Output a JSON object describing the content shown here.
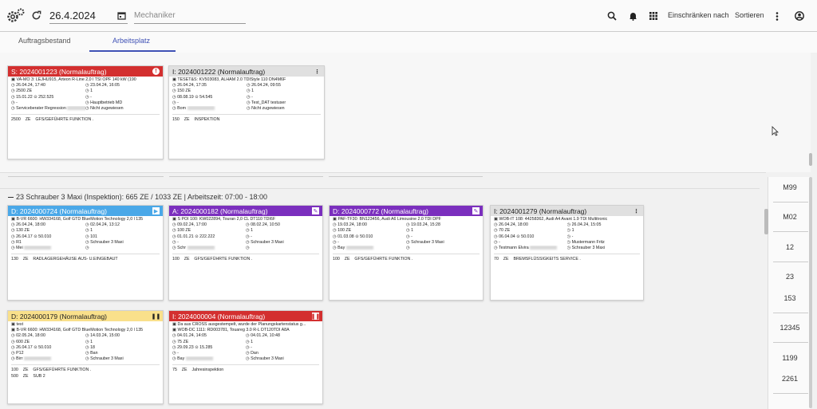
{
  "topbar": {
    "date": "26.4.2024",
    "mechanic_placeholder": "Mechaniker",
    "restrict": "Einschränken nach",
    "sort": "Sortieren"
  },
  "tabs": [
    "Auftragsbestand",
    "Arbeitsplatz"
  ],
  "group_header": "23 Schrauber 3 Maxi (Inspektion): 665 ZE / 1033 ZE | Arbeitszeit: 07:00 - 18:00",
  "side_values": [
    "M99",
    "M02",
    "12",
    "23",
    "153",
    "12345",
    "1199",
    "2261"
  ],
  "cards": [
    {
      "title": "S: 2024001223 (Normalauftrag)",
      "color": "red",
      "flag": "!",
      "vehicle": "VA-MO 3: LEJHU915, Arteon R-Line 2,0 l TSI OPF 140 kW (190",
      "l1": "26.04.24, 17:40",
      "r1": "23.04.24, 16:05",
      "l2": "2500 ZE",
      "r2": "1",
      "l3": "15.01.22",
      "l3b": "252.525",
      "r3": "-",
      "l4": "-",
      "r4": "Hauptbetrieb MD",
      "l5": "Serviceberater Regression",
      "r5": "Nicht zugewiesen",
      "f1a": "2500",
      "f1b": "ZE",
      "f1c": "GFS/GEFÜHRTE FUNKTION ."
    },
    {
      "title": "I: 2024001222 (Normalauftrag)",
      "color": "grey",
      "vehicle": "TESET&S: KV503083, ALHAM 2.0 TDIStyle 110 DN4M6F",
      "l1": "26.04.24, 17:35",
      "r1": "26.04.24, 09:55",
      "l2": "150 ZE",
      "r2": "1",
      "l3": "08.08.19",
      "l3b": "54.545",
      "r3": "-",
      "l4": "-",
      "r4": "Test_DAT testuser",
      "l5": "Bom",
      "r5": "Nicht zugewiesen",
      "f1a": "150",
      "f1b": "ZE",
      "f1c": "INSPEKTION"
    },
    {
      "title": "D: 2024000724 (Normalauftrag)",
      "color": "blue",
      "vehicle": "B-VR 6600: HW334168, Golf GTD BlueMotion Technology 2,0 l 135",
      "l1": "26.04.24, 18:00",
      "r1": "02.04.24, 13:12",
      "l2": "130 ZE",
      "r2": "1",
      "l3": "26.04.17",
      "l3b": "50.010",
      "r3": "101",
      "l4": "R1",
      "r4": "Schrauber 3 Maxi",
      "l5": "Mei",
      "r5": "",
      "f1a": "130",
      "f1b": "ZE",
      "f1c": "RADLAGERGEHÄUSE AUS- U.EINGEBAUT"
    },
    {
      "title": "A: 2024000182 (Normalauftrag)",
      "color": "purple",
      "vehicle": "S POI 100: KW022894, Touran 2,0 CL DT110 TDI6F",
      "l1": "09.02.24, 17:00",
      "r1": "08.02.24, 10:50",
      "l2": "100 ZE",
      "r2": "1",
      "l3": "01.01.21",
      "l3b": "222.222",
      "r3": "-",
      "l4": "-",
      "r4": "Schrauber 3 Maxi",
      "l5": "Schr",
      "r5": "",
      "f1a": "100",
      "f1b": "ZE",
      "f1c": "GFS/GEFÜHRTE FUNKTION ."
    },
    {
      "title": "D: 2024000772 (Normalauftrag)",
      "color": "purple",
      "vehicle": "PAF-TF30: BN123456, Audi A6 Limousine 2.0 TDI DPF",
      "l1": "19.03.24, 18:00",
      "r1": "19.03.24, 15:28",
      "l2": "100 ZE",
      "r2": "1",
      "l3": "01.03.08",
      "l3b": "50.010",
      "r3": "-",
      "l4": "-",
      "r4": "Schrauber 3 Maxi",
      "l5": "Bay",
      "r5": "",
      "f1a": "100",
      "f1b": "ZE",
      "f1c": "GFS/GEFÜHRTE FUNKTION ."
    },
    {
      "title": "I: 2024001279 (Normalauftrag)",
      "color": "grey",
      "vehicle": "WOB-IT 108: 44258362, Audi A4 Avant 1.9 TDI Multitronic",
      "l1": "26.04.24, 18:00",
      "r1": "26.04.24, 15:05",
      "l2": "70 ZE",
      "r2": "1",
      "l3": "06.04.04",
      "l3b": "50.010",
      "r3": "-",
      "l4": "-",
      "r4": "Mustermann Fritz",
      "l5": "Testmann Elvira",
      "r5": "Schrauber 3 Maxi",
      "f1a": "70",
      "f1b": "ZE",
      "f1c": "BREMSFLÜSSIGKEITS SERVICE ."
    },
    {
      "title": "D: 2024000179 (Normalauftrag)",
      "color": "yellow",
      "vehicle": "test",
      "vehicle2": "B-VR 6600: HW334168, Golf GTD BlueMotion Technology 2,0 l 135",
      "l1": "02.05.24, 18:00",
      "r1": "14.03.24, 15:00",
      "l2": "600 ZE",
      "r2": "1",
      "l3": "26.04.17",
      "l3b": "50.010",
      "r3": "18",
      "l4": "P12",
      "r4": "Ban",
      "l5": "Birr",
      "r5": "Schrauber 3 Maxi",
      "f1a": "100",
      "f1b": "ZE",
      "f1c": "GFS/GEFÜHRTE FUNKTION .",
      "f2a": "500",
      "f2b": "ZE",
      "f2c": "SUB 2"
    },
    {
      "title": "I: 2024000004 (Normalauftrag)",
      "color": "red",
      "vehicle": "Da aus CROSS ausgestempelt, wurde der Planungskartenstatus g...",
      "vehicle2": "WOB-DC 1111: RD003781, Touareg 3.0 R-L DT120TDI A8A",
      "l1": "04.01.24, 14:05",
      "r1": "04.01.24, 10:48",
      "l2": "75 ZE",
      "r2": "1",
      "l3": "29.09.23",
      "l3b": "15.285",
      "r3": "-",
      "l4": "-",
      "r4": "Dan",
      "l5": "Bay",
      "r5": "Schrauber 3 Maxi",
      "f1a": "75",
      "f1b": "ZE",
      "f1c": "Jahresinspektion"
    }
  ]
}
